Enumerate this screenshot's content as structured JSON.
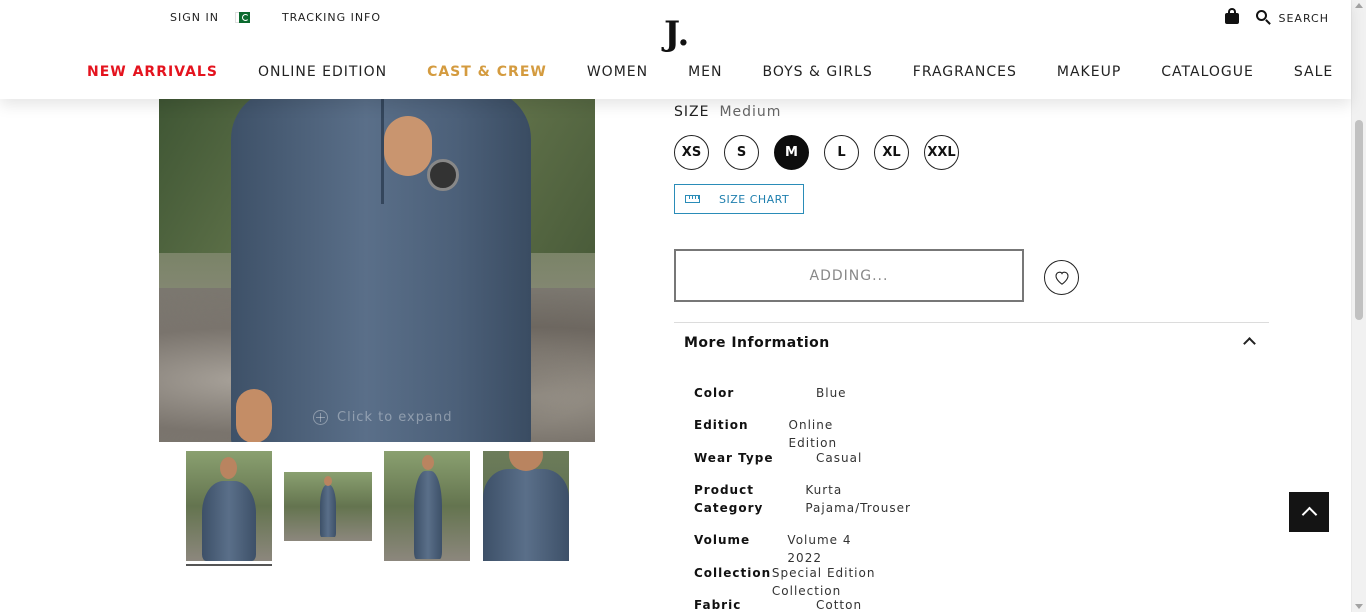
{
  "header": {
    "sign_in": "SIGN IN",
    "tracking_info": "TRACKING INFO",
    "logo": "J.",
    "search": "SEARCH",
    "nav": [
      {
        "label": "NEW ARRIVALS",
        "color": "#e4131e"
      },
      {
        "label": "ONLINE EDITION"
      },
      {
        "label": "CAST & CREW",
        "color": "#d49b3f"
      },
      {
        "label": "WOMEN"
      },
      {
        "label": "MEN"
      },
      {
        "label": "BOYS & GIRLS"
      },
      {
        "label": "FRAGRANCES"
      },
      {
        "label": "MAKEUP"
      },
      {
        "label": "CATALOGUE"
      },
      {
        "label": "SALE"
      }
    ]
  },
  "gallery": {
    "expand_hint": "Click to expand",
    "thumbnail_count": 4,
    "active_thumbnail": 1
  },
  "product": {
    "size_label": "SIZE",
    "selected_size": "Medium",
    "sizes": [
      "XS",
      "S",
      "M",
      "L",
      "XL",
      "XXL"
    ],
    "active_size": "M",
    "size_chart": "SIZE CHART",
    "add_button": "ADDING...",
    "wishlist_icon": "heart-icon"
  },
  "more_info": {
    "title": "More Information",
    "rows": [
      {
        "key": "Color",
        "value": "Blue"
      },
      {
        "key": "Edition",
        "value": "Online Edition"
      },
      {
        "key": "Wear Type",
        "value": "Casual"
      },
      {
        "key": "Product Category",
        "value": "Kurta Pajama/Trouser"
      },
      {
        "key": "Volume",
        "value": "Volume 4 2022"
      },
      {
        "key": "Collection",
        "value": "Special Edition Collection"
      },
      {
        "key": "Fabric",
        "value": "Cotton"
      }
    ]
  },
  "accent_color": "#2a8cb8"
}
